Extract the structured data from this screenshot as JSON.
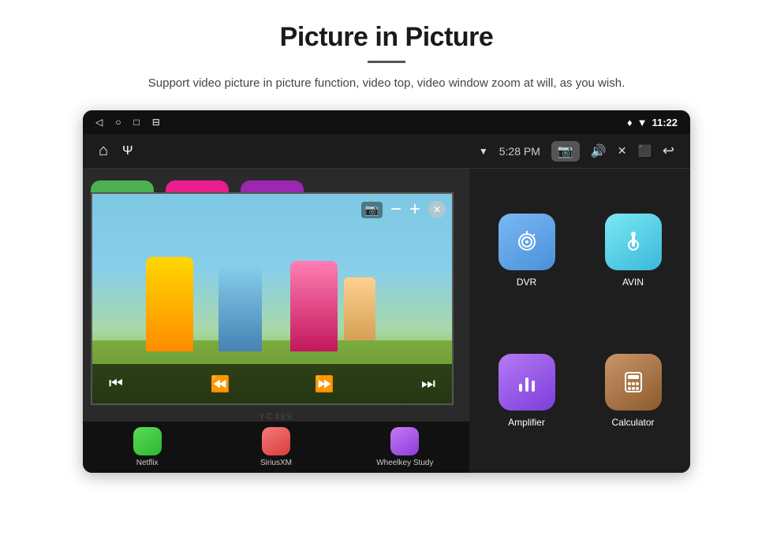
{
  "page": {
    "title": "Picture in Picture",
    "divider": true,
    "subtitle": "Support video picture in picture function, video top, video window zoom at will, as you wish."
  },
  "device": {
    "statusBar": {
      "left": [
        "◁",
        "○",
        "□",
        "⊟"
      ],
      "right_icons": [
        "♦",
        "▼"
      ],
      "time": "11:22"
    },
    "navBar": {
      "left": [
        "⌂",
        "Ψ"
      ],
      "center_time": "5:28 PM",
      "right_icons": [
        "📷",
        "🔊",
        "✕",
        "⬛",
        "↩"
      ]
    },
    "pip": {
      "minus": "−",
      "plus": "+",
      "close": "✕",
      "controls": [
        "⏮",
        "⏪",
        "⏩",
        "⏭"
      ]
    },
    "apps": {
      "grid": [
        {
          "id": "dvr",
          "label": "DVR",
          "icon": "dvr"
        },
        {
          "id": "avin",
          "label": "AVIN",
          "icon": "avin"
        },
        {
          "id": "amplifier",
          "label": "Amplifier",
          "icon": "amplifier"
        },
        {
          "id": "calculator",
          "label": "Calculator",
          "icon": "calculator"
        }
      ],
      "bottom": [
        {
          "id": "netflix",
          "label": "Netflix",
          "icon": "netflix"
        },
        {
          "id": "siriusxm",
          "label": "SiriusXM",
          "icon": "siriusxm"
        },
        {
          "id": "wheelkey",
          "label": "Wheelkey Study",
          "icon": "wheelkey"
        }
      ]
    },
    "watermark": "YC399"
  }
}
